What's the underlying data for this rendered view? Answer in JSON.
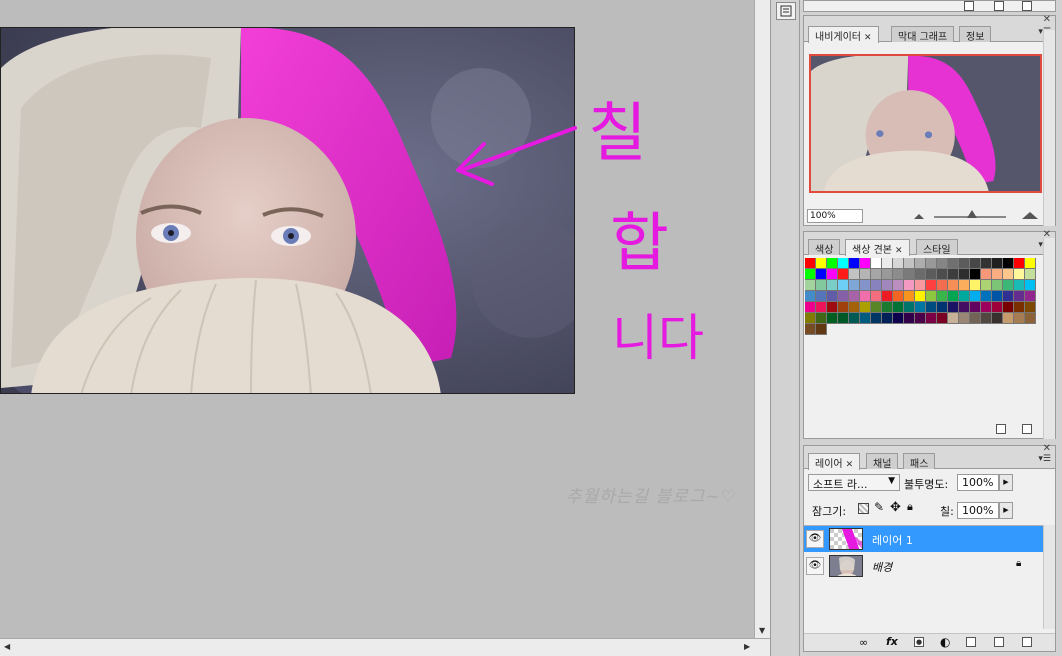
{
  "canvas": {
    "annotation": {
      "line1": "칠",
      "line2": "합",
      "line3": "니다"
    },
    "watermark": "추월하는길 블로그~♡"
  },
  "navigator_panel": {
    "tabs": [
      {
        "label": "내비게이터",
        "active": true,
        "closable": true
      },
      {
        "label": "막대 그래프",
        "active": false,
        "closable": false
      },
      {
        "label": "정보",
        "active": false,
        "closable": false
      }
    ],
    "zoom": "100%",
    "view_box_color": "#e14b3e"
  },
  "swatches_panel": {
    "tabs": [
      {
        "label": "색상",
        "active": false,
        "closable": false
      },
      {
        "label": "색상 견본",
        "active": true,
        "closable": true
      },
      {
        "label": "스타일",
        "active": false,
        "closable": false
      }
    ],
    "colors": [
      "#ff0000",
      "#ffff00",
      "#00ff00",
      "#00ffff",
      "#0000ff",
      "#ff00ff",
      "#ffffff",
      "#ebebeb",
      "#d6d6d6",
      "#c2c2c2",
      "#adadad",
      "#999999",
      "#858585",
      "#707070",
      "#5c5c5c",
      "#474747",
      "#333333",
      "#1f1f1f",
      "#000000",
      "#ff0000",
      "#ffff00",
      "#00ff00",
      "#0000ff",
      "#ff00ff",
      "#ff1a1a",
      "#c2c2c2",
      "#b5b5b5",
      "#a6a6a6",
      "#999999",
      "#8c8c8c",
      "#7a7a7a",
      "#6b6b6b",
      "#5c5c5c",
      "#4d4d4d",
      "#3d3d3d",
      "#2e2e2e",
      "#000000",
      "#f7977a",
      "#f9ad81",
      "#fdc68a",
      "#fff79a",
      "#c4df9b",
      "#a2d39c",
      "#82ca9d",
      "#7bcdc8",
      "#6ecff6",
      "#7ea7d8",
      "#8493ca",
      "#8882be",
      "#a187be",
      "#bc8dbf",
      "#f49ac2",
      "#f6989d",
      "#ff4040",
      "#f26c4f",
      "#f68e55",
      "#fbaf5c",
      "#fff467",
      "#acd372",
      "#7cc576",
      "#3bb878",
      "#1abbb4",
      "#00bff3",
      "#438cca",
      "#5574b9",
      "#605ca8",
      "#855fa8",
      "#a763a8",
      "#f06ea9",
      "#f26d7d",
      "#ed1c24",
      "#f26522",
      "#f7941d",
      "#fff200",
      "#8dc63f",
      "#39b54a",
      "#00a651",
      "#00a99d",
      "#00aeef",
      "#0072bc",
      "#0054a6",
      "#2e3192",
      "#662d91",
      "#92278f",
      "#ec008c",
      "#ed145b",
      "#9e0b0f",
      "#a0410d",
      "#a36209",
      "#aba000",
      "#598527",
      "#1a7b30",
      "#007236",
      "#00746b",
      "#0076a3",
      "#004b80",
      "#003471",
      "#1b1464",
      "#440e62",
      "#630460",
      "#9e005d",
      "#9e0039",
      "#790000",
      "#7b2e00",
      "#7d4900",
      "#827b00",
      "#406618",
      "#005e20",
      "#005826",
      "#005952",
      "#005b7f",
      "#003663",
      "#002157",
      "#0d004c",
      "#32004b",
      "#4b0049",
      "#7b0046",
      "#7a0026",
      "#c7b299",
      "#998675",
      "#736357",
      "#534741",
      "#37302d",
      "#c69c6d",
      "#a67c52",
      "#8c6239",
      "#754c24",
      "#603913"
    ]
  },
  "layers_panel": {
    "tabs": [
      {
        "label": "레이어",
        "active": true,
        "closable": true
      },
      {
        "label": "채널",
        "active": false,
        "closable": false
      },
      {
        "label": "패스",
        "active": false,
        "closable": false
      }
    ],
    "blend_mode": "소프트 라...",
    "opacity_label": "불투명도:",
    "opacity": "100%",
    "lock_label": "잠그기:",
    "fill_label": "칠:",
    "fill": "100%",
    "selected_color": "#3399ff",
    "layers": [
      {
        "name": "레이어 1",
        "selected": true,
        "locked": false
      },
      {
        "name": "배경",
        "selected": false,
        "locked": true
      }
    ],
    "bottom_icons": [
      "link-icon",
      "fx-icon",
      "mask-icon",
      "adjustment-icon",
      "group-icon",
      "new-layer-icon",
      "trash-icon"
    ]
  }
}
